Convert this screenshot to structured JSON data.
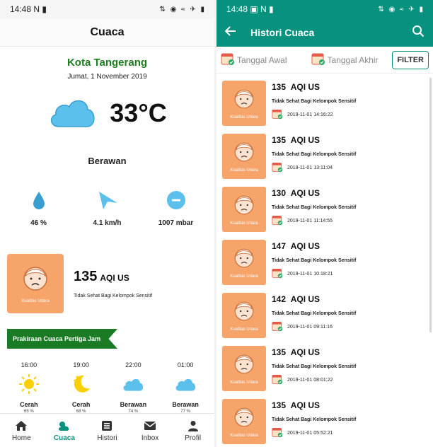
{
  "left": {
    "status": {
      "time": "14:48",
      "left_icons": "N ▮",
      "right_icons": "⇅ ◉ ≈ ✈ ▮"
    },
    "header_title": "Cuaca",
    "city": "Kota Tangerang",
    "date": "Jumat, 1 November 2019",
    "temperature": "33°C",
    "condition": "Berawan",
    "metrics": [
      {
        "icon": "humidity-drop-icon",
        "value": "46 %"
      },
      {
        "icon": "wind-direction-icon",
        "value": "4.1 km/h"
      },
      {
        "icon": "pressure-gauge-icon",
        "value": "1007 mbar"
      }
    ],
    "aqi": {
      "box_label": "Kualitas Udara",
      "value": "135",
      "unit": "AQI US",
      "description": "Tidak Sehat Bagi Kelompok Sensitif"
    },
    "forecast_title": "Prakiraan Cuaca Pertiga Jam",
    "forecast": [
      {
        "time": "16:00",
        "icon": "sun-icon",
        "condition": "Cerah",
        "humidity": "65 %"
      },
      {
        "time": "19:00",
        "icon": "moon-stars-icon",
        "condition": "Cerah",
        "humidity": "68 %"
      },
      {
        "time": "22:00",
        "icon": "cloud-icon",
        "condition": "Berawan",
        "humidity": "74 %"
      },
      {
        "time": "01:00",
        "icon": "cloud-icon",
        "condition": "Berawan",
        "humidity": "77 %"
      }
    ],
    "nav": [
      {
        "label": "Home",
        "icon": "home-icon"
      },
      {
        "label": "Cuaca",
        "icon": "weather-icon",
        "active": true
      },
      {
        "label": "Histori",
        "icon": "history-icon"
      },
      {
        "label": "Inbox",
        "icon": "inbox-icon"
      },
      {
        "label": "Profil",
        "icon": "profile-icon"
      }
    ]
  },
  "right": {
    "status": {
      "time": "14:48",
      "left_icons": "▣ N ▮",
      "right_icons": "⇅ ◉ ≈ ✈ ▮"
    },
    "header_title": "Histori Cuaca",
    "filter": {
      "start_label": "Tanggal Awal",
      "end_label": "Tanggal Akhir",
      "button": "FILTER"
    },
    "items": [
      {
        "value": "135",
        "unit": "AQI US",
        "box_label": "Kualitas Udara",
        "description": "Tidak Sehat Bagi Kelompok Sensitif",
        "timestamp": "2019-11-01 14:16:22"
      },
      {
        "value": "135",
        "unit": "AQI US",
        "box_label": "Kualitas Udara",
        "description": "Tidak Sehat Bagi Kelompok Sensitif",
        "timestamp": "2019-11-01 13:11:04"
      },
      {
        "value": "130",
        "unit": "AQI US",
        "box_label": "Kualitas Udara",
        "description": "Tidak Sehat Bagi Kelompok Sensitif",
        "timestamp": "2019-11-01 11:14:55"
      },
      {
        "value": "147",
        "unit": "AQI US",
        "box_label": "Kualitas Udara",
        "description": "Tidak Sehat Bagi Kelompok Sensitif",
        "timestamp": "2019-11-01 10:18:21"
      },
      {
        "value": "142",
        "unit": "AQI US",
        "box_label": "Kualitas Udara",
        "description": "Tidak Sehat Bagi Kelompok Sensitif",
        "timestamp": "2019-11-01 09:11:16"
      },
      {
        "value": "135",
        "unit": "AQI US",
        "box_label": "Kualitas Udara",
        "description": "Tidak Sehat Bagi Kelompok Sensitif",
        "timestamp": "2019-11-01 08:01:22"
      },
      {
        "value": "135",
        "unit": "AQI US",
        "box_label": "Kualitas Udara",
        "description": "Tidak Sehat Bagi Kelompok Sensitif",
        "timestamp": "2019-11-01 05:52:21"
      }
    ]
  },
  "colors": {
    "teal": "#07917f",
    "green": "#1b7a24",
    "orange": "#f7a46b",
    "sky": "#5bc0eb"
  }
}
